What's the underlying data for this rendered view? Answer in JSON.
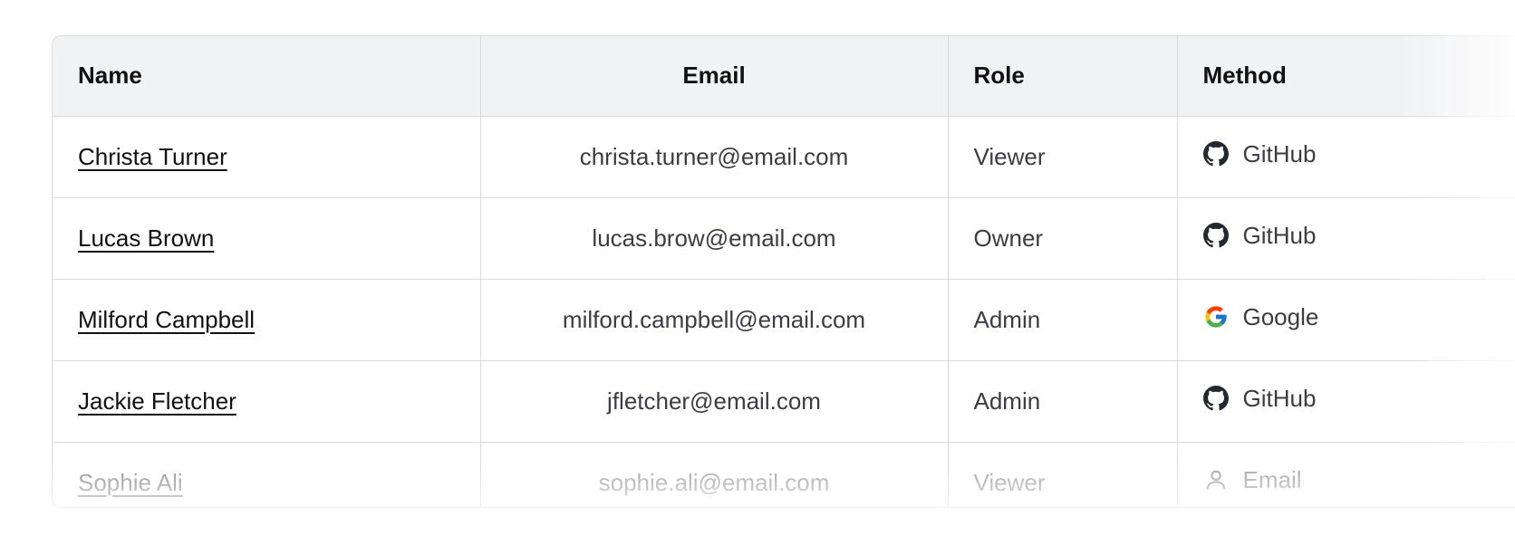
{
  "table": {
    "headers": {
      "name": "Name",
      "email": "Email",
      "role": "Role",
      "method": "Method"
    },
    "rows": [
      {
        "name": "Christa Turner",
        "email": "christa.turner@email.com",
        "role": "Viewer",
        "method": "GitHub",
        "method_icon": "github-icon"
      },
      {
        "name": "Lucas Brown",
        "email": "lucas.brow@email.com",
        "role": "Owner",
        "method": "GitHub",
        "method_icon": "github-icon"
      },
      {
        "name": "Milford Campbell",
        "email": "milford.campbell@email.com",
        "role": "Admin",
        "method": "Google",
        "method_icon": "google-icon"
      },
      {
        "name": "Jackie Fletcher",
        "email": "jfletcher@email.com",
        "role": "Admin",
        "method": "GitHub",
        "method_icon": "github-icon"
      },
      {
        "name": "Sophie Ali",
        "email": "sophie.ali@email.com",
        "role": "Viewer",
        "method": "Email",
        "method_icon": "user-icon"
      }
    ]
  },
  "colors": {
    "header_bg": "#f1f2f4",
    "border": "#d9dbde",
    "text": "#3b3d42"
  }
}
